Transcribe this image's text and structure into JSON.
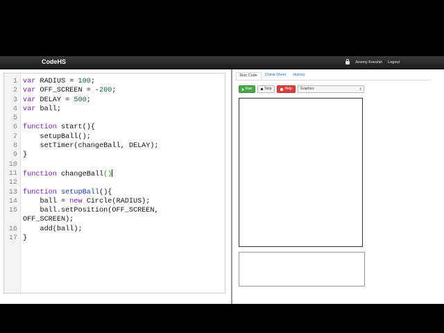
{
  "navbar": {
    "brand": "CodeHS",
    "user_name": "Jeremy Keeshin",
    "logout_label": "Logout"
  },
  "editor": {
    "lines": [
      {
        "num": "1",
        "html": "<span class='kw'>var</span> RADIUS = <span class='num'>100</span>;"
      },
      {
        "num": "2",
        "html": "<span class='kw'>var</span> OFF_SCREEN = -<span class='num'>200</span>;"
      },
      {
        "num": "3",
        "html": "<span class='kw'>var</span> DELAY = <span class='num'>500</span>;"
      },
      {
        "num": "4",
        "html": "<span class='kw'>var</span> ball;"
      },
      {
        "num": "5",
        "html": ""
      },
      {
        "num": "6",
        "html": "<span class='kw'>function</span> start(){"
      },
      {
        "num": "7",
        "html": "    setupBall();"
      },
      {
        "num": "8",
        "html": "    setTimer(changeBall, DELAY);"
      },
      {
        "num": "9",
        "html": "}"
      },
      {
        "num": "10",
        "html": ""
      },
      {
        "num": "11",
        "html": "<span class='kw'>function</span> changeBall<span class='paren'>()</span><span class='cursor'></span>"
      },
      {
        "num": "12",
        "html": ""
      },
      {
        "num": "13",
        "html": "<span class='kw'>function</span> <span class='fn'>setupBall</span>(){"
      },
      {
        "num": "14",
        "html": "    ball = <span class='kw'>new</span> Circle(RADIUS);"
      },
      {
        "num": "15",
        "html": "    ball.setPosition(OFF_SCREEN,"
      },
      {
        "num": "",
        "html": "OFF_SCREEN);"
      },
      {
        "num": "16",
        "html": "    add(ball);"
      },
      {
        "num": "17",
        "html": "}"
      }
    ]
  },
  "right_panel": {
    "tabs": [
      {
        "label": "Run Code",
        "active": true
      },
      {
        "label": "Cheat Sheet",
        "active": false
      },
      {
        "label": "History",
        "active": false
      }
    ],
    "run_label": "Run",
    "stop_label": "Stop",
    "help_label": "Help",
    "mode_select": "Graphics"
  }
}
